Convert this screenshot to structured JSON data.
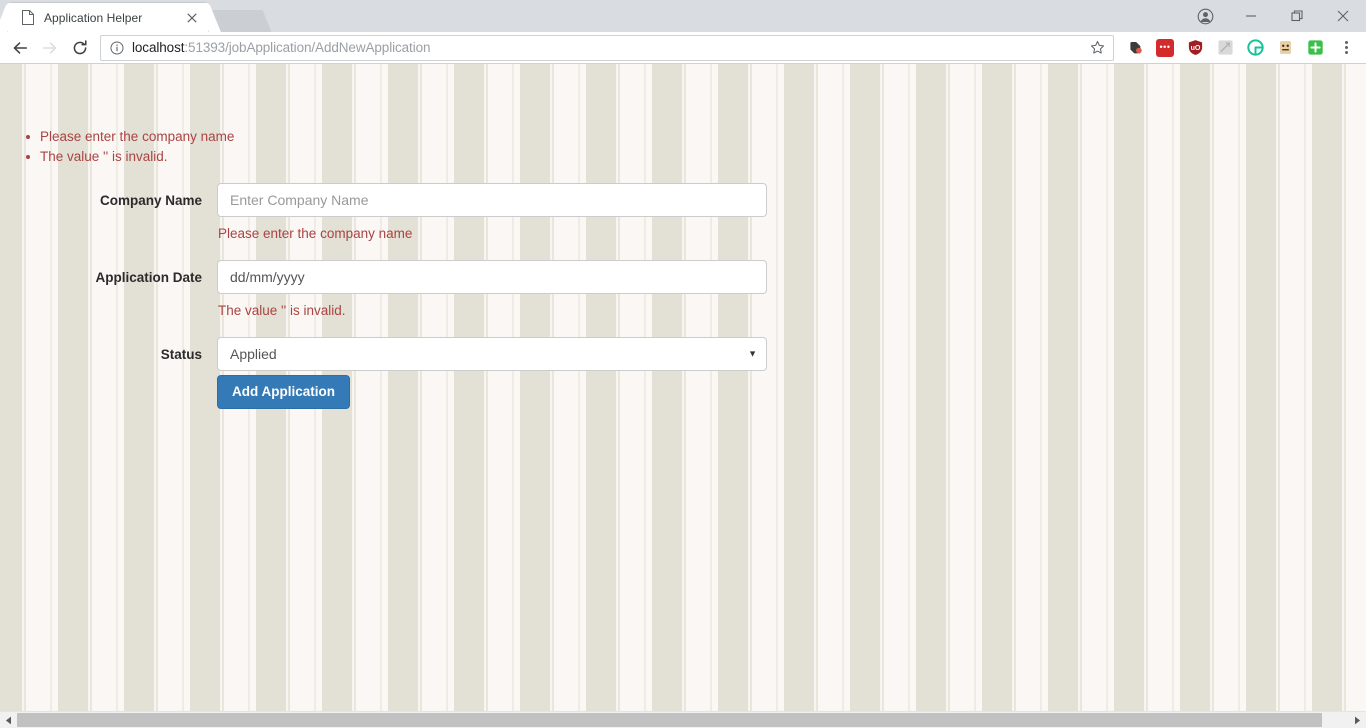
{
  "browser": {
    "tab": {
      "title": "Application Helper",
      "favicon_icon": "page-icon",
      "close_icon": "close-icon"
    },
    "new_tab_icon": "new-tab-icon",
    "window_controls": {
      "profile_icon": "profile-avatar-icon",
      "minimize_icon": "minimize-icon",
      "maximize_icon": "restore-window-icon",
      "close_icon": "close-window-icon"
    },
    "nav": {
      "back_icon": "back-arrow-icon",
      "forward_icon": "forward-arrow-icon",
      "reload_icon": "reload-icon"
    },
    "omnibox": {
      "info_icon": "page-info-icon",
      "url_host": "localhost",
      "url_path": ":51393/jobApplication/AddNewApplication",
      "full_url": "localhost:51393/jobApplication/AddNewApplication",
      "star_icon": "bookmark-star-icon"
    },
    "extensions": [
      {
        "name": "evernote-extension-icon",
        "glyph": "◖",
        "bg": "#f7f7f7",
        "fg": "#3b3b3b"
      },
      {
        "name": "password-manager-extension-icon",
        "glyph": "•••",
        "bg": "#d32b2b",
        "fg": "#ffffff"
      },
      {
        "name": "ublock-origin-extension-icon",
        "glyph": "Ⓤ",
        "bg": "#a21d21",
        "fg": "#ffffff"
      },
      {
        "name": "disabled-extension-icon",
        "glyph": "↗",
        "bg": "#d0d0d0",
        "fg": "#ffffff"
      },
      {
        "name": "grammarly-extension-icon",
        "glyph": "G",
        "bg": "#15c39a",
        "fg": "#ffffff"
      },
      {
        "name": "honey-extension-icon",
        "glyph": "■",
        "bg": "#e5c9a0",
        "fg": "#5a3a12"
      },
      {
        "name": "add-extension-icon",
        "glyph": "+",
        "bg": "#3ac04a",
        "fg": "#ffffff"
      }
    ],
    "menu_icon": "browser-menu-icon",
    "scrollbar": {
      "left_arrow_icon": "scroll-left-arrow-icon",
      "right_arrow_icon": "scroll-right-arrow-icon"
    }
  },
  "page": {
    "validation_summary": [
      "Please enter the company name",
      "The value '' is invalid."
    ],
    "form": {
      "company": {
        "label": "Company Name",
        "value": "",
        "placeholder": "Enter Company Name",
        "error": "Please enter the company name"
      },
      "application_date": {
        "label": "Application Date",
        "value": "dd/mm/yyyy",
        "placeholder": "dd/mm/yyyy",
        "error": "The value '' is invalid."
      },
      "status": {
        "label": "Status",
        "selected": "Applied",
        "options": [
          "Applied"
        ]
      },
      "submit_label": "Add Application"
    }
  },
  "colors": {
    "primary": "#337ab7",
    "primary_border": "#2e6da4",
    "danger_text": "#a94442",
    "stripe_dark": "#e3e0d5",
    "stripe_light": "#faf7f5",
    "input_border": "#cccccc"
  }
}
